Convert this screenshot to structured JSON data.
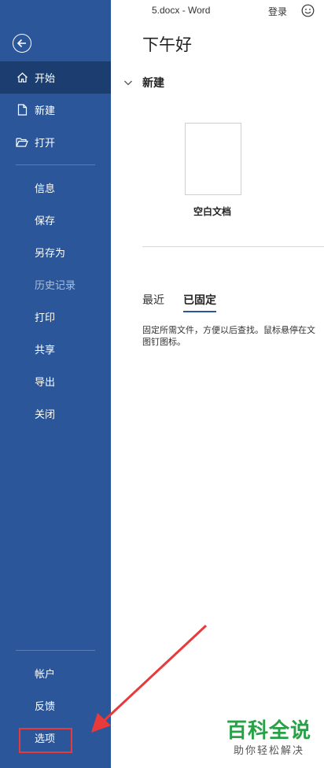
{
  "window": {
    "title": "5.docx  -  Word",
    "signin": "登录"
  },
  "greeting": "下午好",
  "sidebar": {
    "items": [
      {
        "label": "开始"
      },
      {
        "label": "新建"
      },
      {
        "label": "打开"
      },
      {
        "label": "信息"
      },
      {
        "label": "保存"
      },
      {
        "label": "另存为"
      },
      {
        "label": "历史记录"
      },
      {
        "label": "打印"
      },
      {
        "label": "共享"
      },
      {
        "label": "导出"
      },
      {
        "label": "关闭"
      }
    ],
    "bottom": [
      {
        "label": "帐户"
      },
      {
        "label": "反馈"
      },
      {
        "label": "选项"
      }
    ]
  },
  "new_section": {
    "title": "新建",
    "blank_doc_label": "空白文档"
  },
  "tabs": [
    {
      "label": "最近"
    },
    {
      "label": "已固定"
    }
  ],
  "pinned_desc": {
    "line1": "固定所需文件，方便以后查找。鼠标悬停在文",
    "line2": "图钉图标。"
  },
  "watermark": {
    "title": "百科全说",
    "subtitle": "助你轻松解决"
  },
  "colors": {
    "sidebar_bg": "#2b579a",
    "active_item": "#1c3d70",
    "highlight": "#e83a3a",
    "watermark_green": "#27a046"
  }
}
